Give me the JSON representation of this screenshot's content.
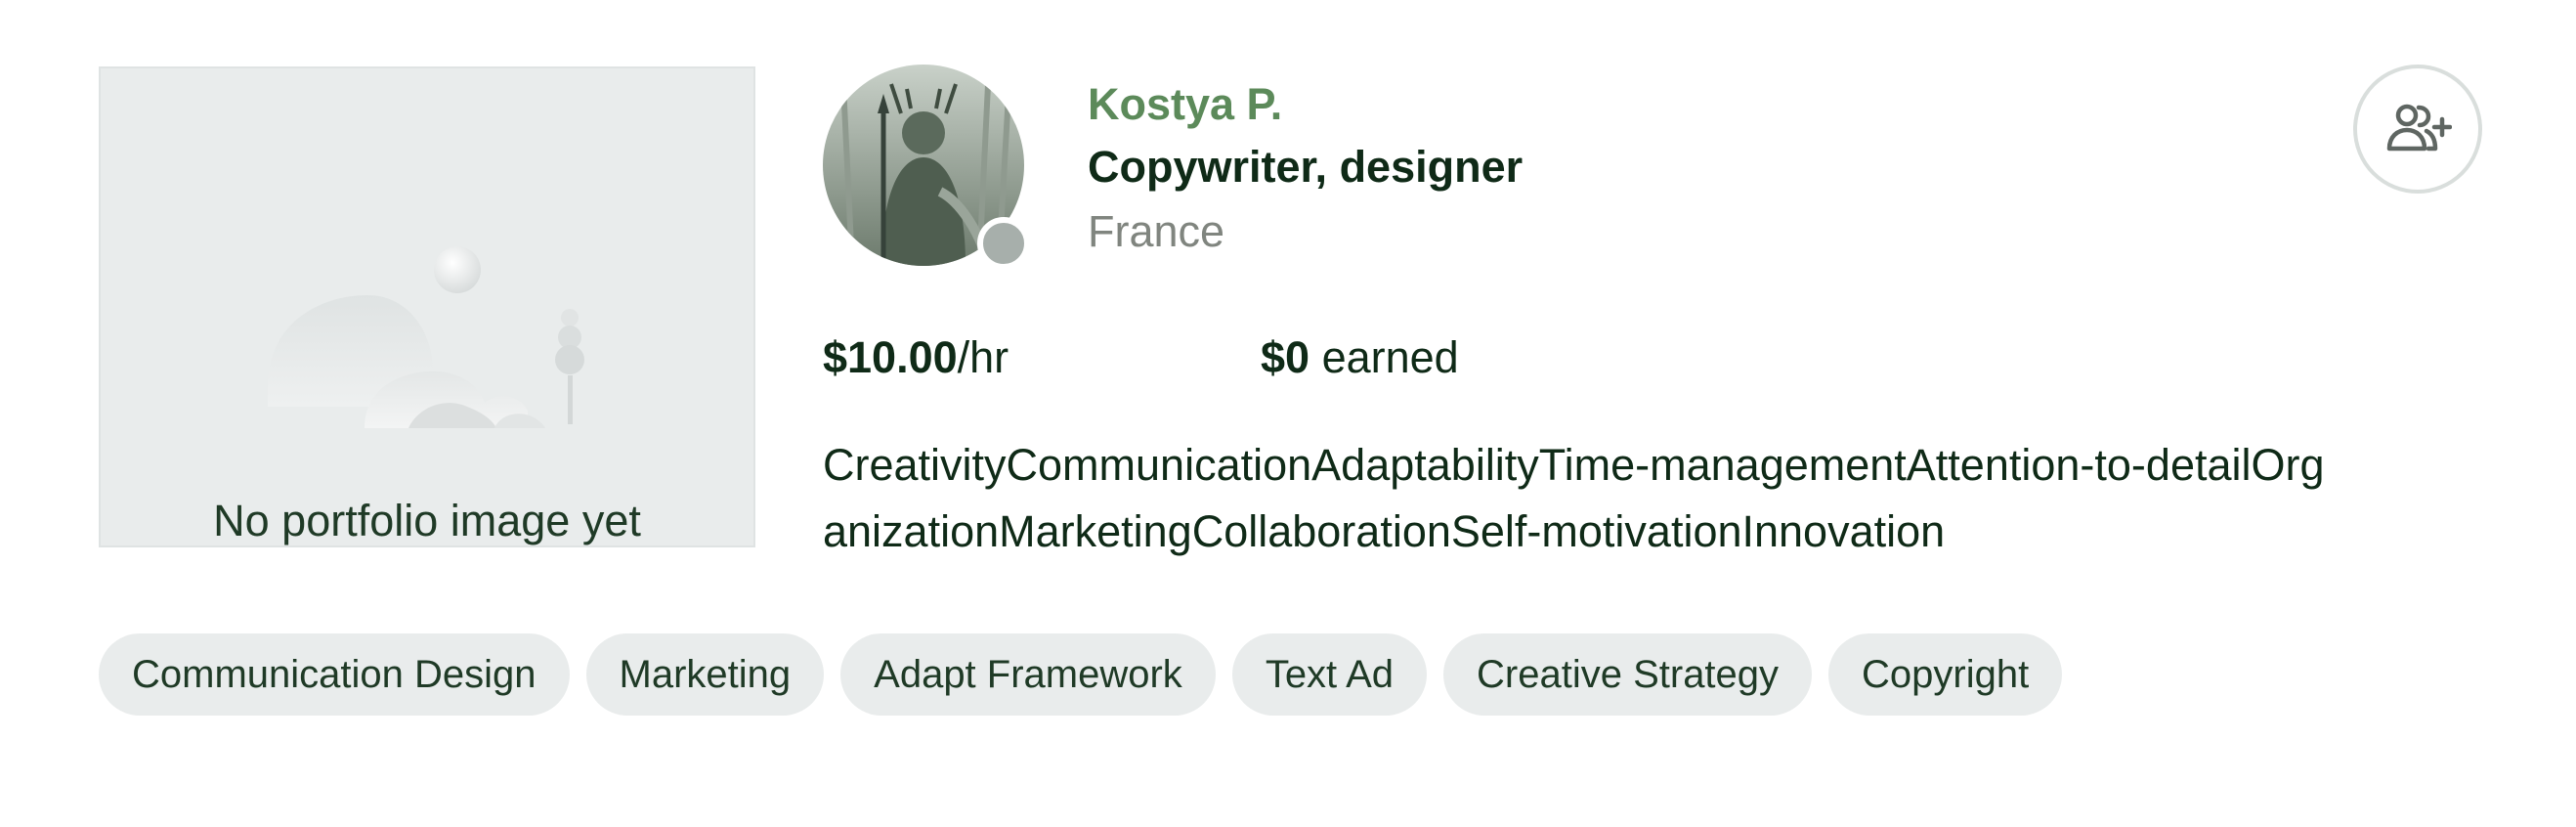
{
  "portfolio": {
    "empty_caption": "No portfolio image yet",
    "illustration_icon": "landscape-placeholder-icon"
  },
  "freelancer": {
    "name": "Kostya P.",
    "title": "Copywriter, designer",
    "location": "France",
    "status": "offline"
  },
  "actions": {
    "invite_icon": "users-plus-icon"
  },
  "stats": {
    "rate_amount": "$10.00",
    "rate_unit": "/hr",
    "earned_amount": "$0",
    "earned_label": "earned"
  },
  "skills_text": "CreativityCommunicationAdaptabilityTime-managementAttention-to-detailOrganizationMarketingCollaborationSelf-motivationInnovation",
  "chips": [
    "Communication Design",
    "Marketing",
    "Adapt Framework",
    "Text Ad",
    "Creative Strategy",
    "Copyright"
  ],
  "colors": {
    "name": "#5c8a5a",
    "text": "#0f2a17",
    "muted": "#80857f",
    "chip_bg": "#e9ecec",
    "status_offline": "#a7afab"
  }
}
